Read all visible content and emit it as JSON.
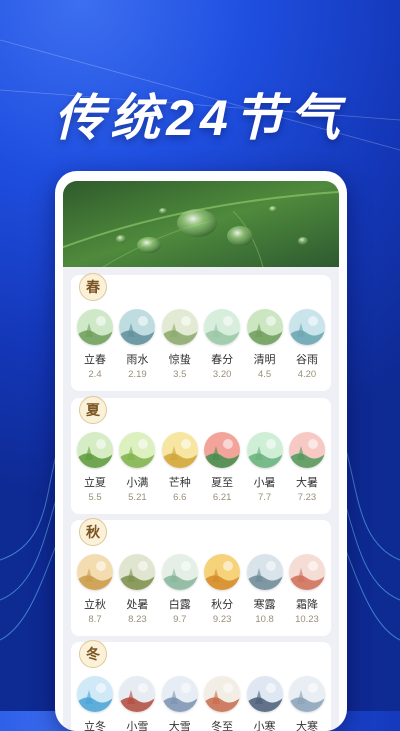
{
  "headline": "传统24节气",
  "seasons": [
    {
      "label": "春",
      "terms": [
        {
          "name": "立春",
          "date": "2.4",
          "icon": "willow-bird-icon",
          "colors": [
            "#cfe8c8",
            "#6e9e5a"
          ]
        },
        {
          "name": "雨水",
          "date": "2.19",
          "icon": "rain-figure-icon",
          "colors": [
            "#bfdde0",
            "#5f8f9a"
          ]
        },
        {
          "name": "惊蛰",
          "date": "3.5",
          "icon": "insect-figure-icon",
          "colors": [
            "#e2ead3",
            "#8aa86a"
          ]
        },
        {
          "name": "春分",
          "date": "3.20",
          "icon": "butterfly-icon",
          "colors": [
            "#d7eedc",
            "#9ac7a5"
          ]
        },
        {
          "name": "清明",
          "date": "4.5",
          "icon": "pavilion-icon",
          "colors": [
            "#cde6c2",
            "#6f9c5c"
          ]
        },
        {
          "name": "谷雨",
          "date": "4.20",
          "icon": "rice-field-icon",
          "colors": [
            "#c9e4ea",
            "#6aa4b0"
          ]
        }
      ]
    },
    {
      "label": "夏",
      "terms": [
        {
          "name": "立夏",
          "date": "5.5",
          "icon": "summer-leaf-icon",
          "colors": [
            "#d6ecc4",
            "#5e9a3c"
          ]
        },
        {
          "name": "小满",
          "date": "5.21",
          "icon": "wheat-icon",
          "colors": [
            "#ddf0c0",
            "#7fb24c"
          ]
        },
        {
          "name": "芒种",
          "date": "6.6",
          "icon": "grain-icon",
          "colors": [
            "#f6e6a2",
            "#d0a43a"
          ]
        },
        {
          "name": "夏至",
          "date": "6.21",
          "icon": "watermelon-icon",
          "colors": [
            "#f2a49a",
            "#3f8f4b"
          ]
        },
        {
          "name": "小暑",
          "date": "7.7",
          "icon": "lotus-leaf-icon",
          "colors": [
            "#cfeed6",
            "#69b07c"
          ]
        },
        {
          "name": "大暑",
          "date": "7.23",
          "icon": "lotus-flower-icon",
          "colors": [
            "#f7c9c4",
            "#4f9a5a"
          ]
        }
      ]
    },
    {
      "label": "秋",
      "terms": [
        {
          "name": "立秋",
          "date": "8.7",
          "icon": "autumn-field-icon",
          "colors": [
            "#f3ddb0",
            "#c99b4a"
          ]
        },
        {
          "name": "处暑",
          "date": "8.23",
          "icon": "autumn-tree-icon",
          "colors": [
            "#dfe5cf",
            "#7c8f4a"
          ]
        },
        {
          "name": "白露",
          "date": "9.7",
          "icon": "dew-grass-icon",
          "colors": [
            "#e6efe6",
            "#86b59a"
          ]
        },
        {
          "name": "秋分",
          "date": "9.23",
          "icon": "osmanthus-icon",
          "colors": [
            "#f6d37a",
            "#d58a2a"
          ]
        },
        {
          "name": "寒露",
          "date": "10.8",
          "icon": "cold-dew-icon",
          "colors": [
            "#d8e3ea",
            "#6d8a96"
          ]
        },
        {
          "name": "霜降",
          "date": "10.23",
          "icon": "frost-tree-icon",
          "colors": [
            "#f5ddd6",
            "#cf6f58"
          ]
        }
      ]
    },
    {
      "label": "冬",
      "terms": [
        {
          "name": "立冬",
          "date": "",
          "icon": "winter-water-icon",
          "colors": [
            "#cfe9f7",
            "#4aa3d6"
          ]
        },
        {
          "name": "小雪",
          "date": "",
          "icon": "snow-house-icon",
          "colors": [
            "#e7ecf2",
            "#b24a3a"
          ]
        },
        {
          "name": "大雪",
          "date": "",
          "icon": "snow-figure-icon",
          "colors": [
            "#e6edf4",
            "#7a93b0"
          ]
        },
        {
          "name": "冬至",
          "date": "",
          "icon": "dumpling-icon",
          "colors": [
            "#f2eee6",
            "#c86a4a"
          ]
        },
        {
          "name": "小寒",
          "date": "",
          "icon": "winter-scene-icon",
          "colors": [
            "#dfe8f2",
            "#4b5d78"
          ]
        },
        {
          "name": "大寒",
          "date": "",
          "icon": "snow-people-icon",
          "colors": [
            "#e8eef4",
            "#8aa0b8"
          ]
        }
      ]
    }
  ]
}
